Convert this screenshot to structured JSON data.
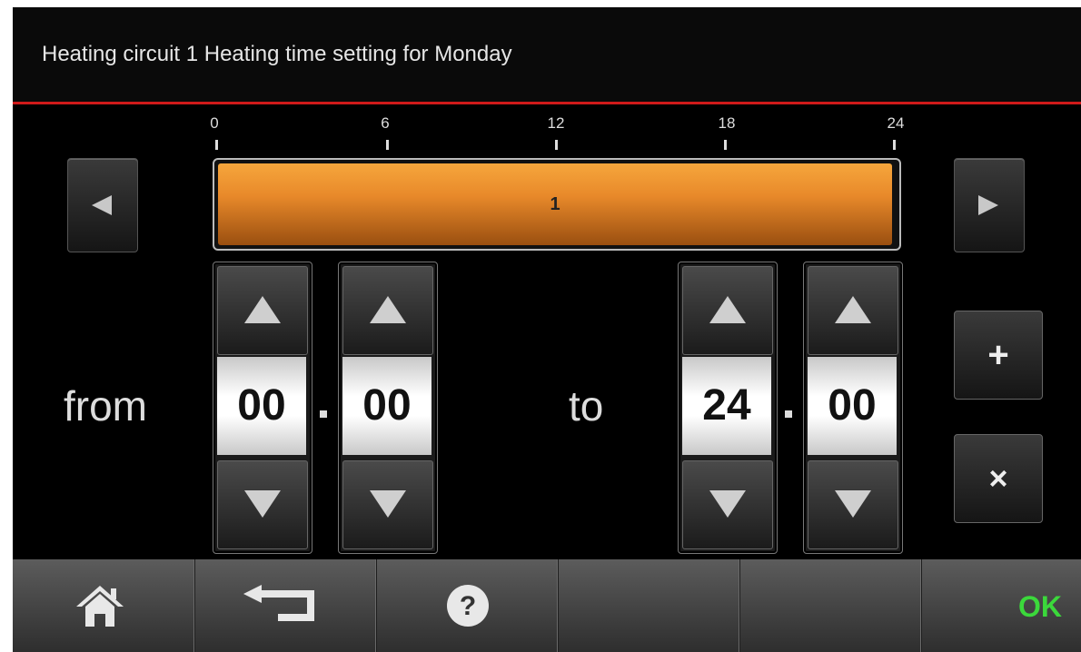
{
  "header": {
    "title": "Heating circuit 1 Heating time setting for Monday"
  },
  "timeline": {
    "ticks": [
      "0",
      "6",
      "12",
      "18",
      "24"
    ],
    "segment_label": "1",
    "segment_start_hour": 0,
    "segment_end_hour": 24,
    "range_hours": [
      0,
      24
    ]
  },
  "from": {
    "label": "from",
    "hours": "00",
    "minutes": "00"
  },
  "to": {
    "label": "to",
    "hours": "24",
    "minutes": "00"
  },
  "side_buttons": {
    "add": "+",
    "delete": "×"
  },
  "footer": {
    "ok": "OK"
  },
  "colors": {
    "accent_line": "#d01a1a",
    "segment": "#e8892a",
    "ok": "#3bd83b"
  },
  "icons": [
    "left-arrow-icon",
    "right-arrow-icon",
    "up-arrow-icon",
    "down-arrow-icon",
    "home-icon",
    "back-icon",
    "help-icon"
  ]
}
